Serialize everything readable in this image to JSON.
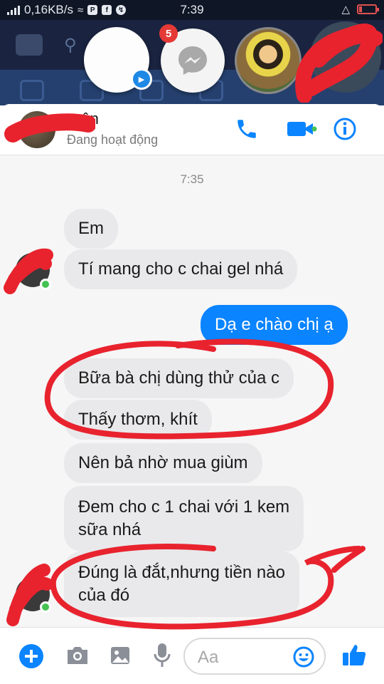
{
  "status_bar": {
    "network_speed": "0,16KB/s",
    "time": "7:39"
  },
  "chat_heads": {
    "messenger_badge": "5"
  },
  "chat_header": {
    "contact_name": "...ên",
    "status": "Đang hoạt động"
  },
  "conversation": {
    "timestamp": "7:35",
    "messages": [
      {
        "text": "Em"
      },
      {
        "text": "Tí mang cho c chai gel nhá"
      },
      {
        "text": "Dạ e chào chị ạ"
      },
      {
        "text": "Bữa bà chị dùng thử của c"
      },
      {
        "text": "Thấy thơm, khít"
      },
      {
        "text": "Nên bả nhờ mua giùm"
      },
      {
        "line1": "Đem cho c 1 chai với 1 kem",
        "line2": "sữa nhá"
      },
      {
        "line1": "Đúng là đắt,nhưng tiền nào",
        "line2": "của đó"
      }
    ]
  },
  "composer": {
    "placeholder": "Aa"
  },
  "colors": {
    "accent": "#0a84ff",
    "online": "#44c252",
    "annotation": "#e8232e"
  }
}
